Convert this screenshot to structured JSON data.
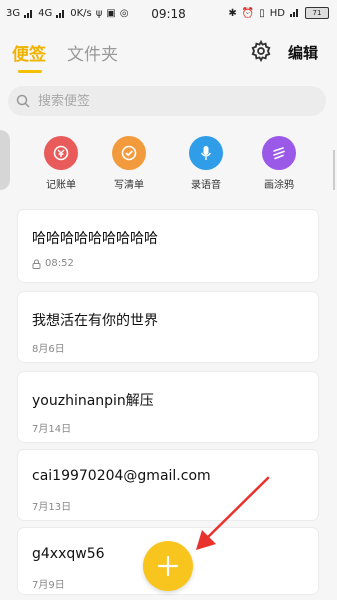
{
  "status_bar": {
    "left": [
      "3G",
      "4G",
      "0K/s"
    ],
    "time": "09:18",
    "right_extra": "HD",
    "battery": "71"
  },
  "header": {
    "tab_notes": "便签",
    "tab_folders": "文件夹",
    "edit_label": "编辑"
  },
  "search": {
    "placeholder": "搜索便签"
  },
  "quick_actions": [
    {
      "label": "记账单",
      "icon": "ledger-icon",
      "color": "#e95a5a"
    },
    {
      "label": "写清单",
      "icon": "checklist-icon",
      "color": "#f39a3c"
    },
    {
      "label": "录语音",
      "icon": "microphone-icon",
      "color": "#2f9de8"
    },
    {
      "label": "画涂鸦",
      "icon": "doodle-icon",
      "color": "#9b59e8"
    }
  ],
  "notes": [
    {
      "title": "哈哈哈哈哈哈哈哈哈",
      "date": "08:52",
      "locked": true
    },
    {
      "title": "我想活在有你的世界",
      "date": "8月6日"
    },
    {
      "title": "youzhinanpin解压",
      "date": "7月14日"
    },
    {
      "title": "cai19970204@gmail.com",
      "date": "7月13日"
    },
    {
      "title": "g4xxqw56",
      "date": "7月9日"
    }
  ],
  "colors": {
    "accent": "#f5c000",
    "fab": "#f7c51e",
    "annotation_arrow": "#e8322b"
  }
}
